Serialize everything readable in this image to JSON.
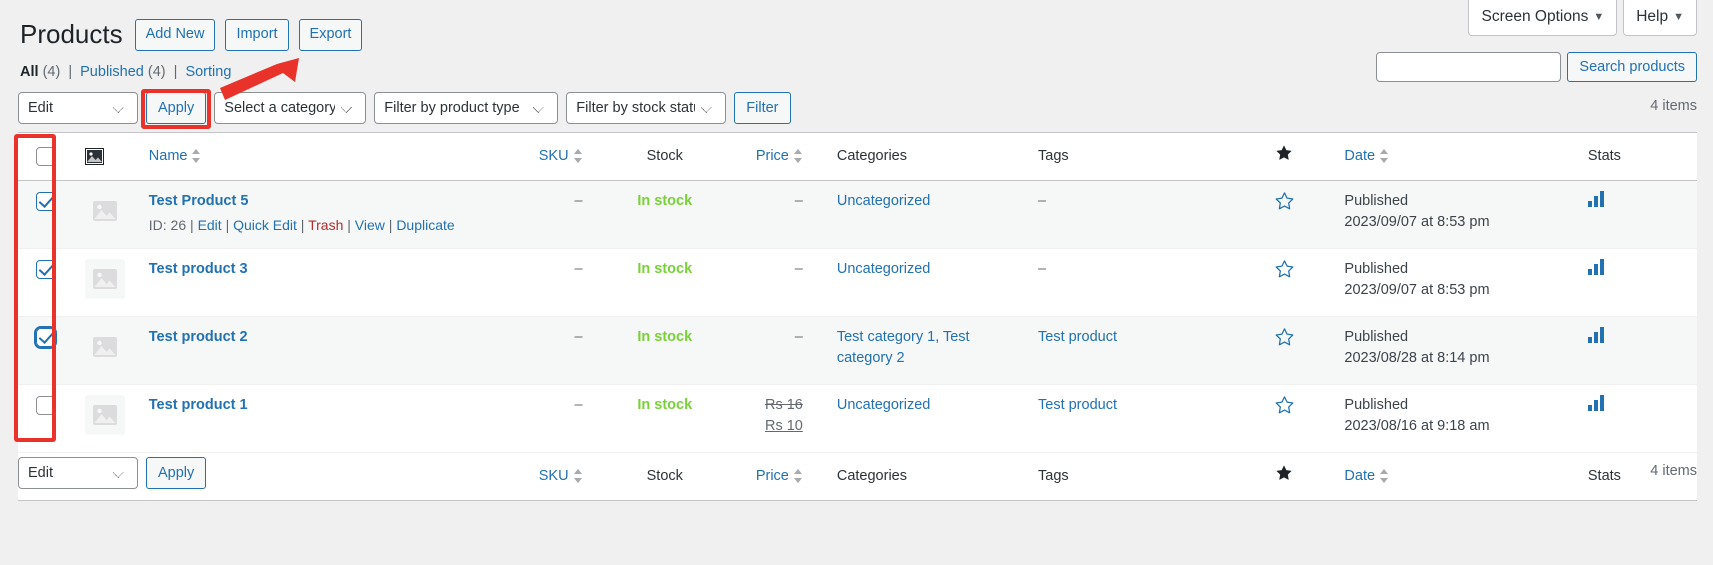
{
  "screen_meta": {
    "screen_options_label": "Screen Options",
    "help_label": "Help",
    "caret": "▼"
  },
  "header": {
    "title": "Products",
    "actions": [
      {
        "label": "Add New",
        "name": "add-new-button"
      },
      {
        "label": "Import",
        "name": "import-button"
      },
      {
        "label": "Export",
        "name": "export-button"
      }
    ]
  },
  "views": {
    "all_label": "All",
    "all_count": "(4)",
    "published_label": "Published",
    "published_count": "(4)",
    "sorting_label": "Sorting",
    "separator": "|"
  },
  "search": {
    "value": "",
    "placeholder": "",
    "submit_label": "Search products"
  },
  "tablenav_top": {
    "bulk_action_value": "Edit",
    "apply_label": "Apply",
    "category_value": "Select a category",
    "product_type_value": "Filter by product type",
    "stock_status_value": "Filter by stock status",
    "filter_label": "Filter",
    "displaying_num": "4 items"
  },
  "tablenav_bottom": {
    "bulk_action_value": "Edit",
    "apply_label": "Apply",
    "displaying_num": "4 items"
  },
  "table": {
    "columns": {
      "cb": "",
      "thumb": "image-icon",
      "name": "Name",
      "sku": "SKU",
      "stock": "Stock",
      "price": "Price",
      "categories": "Categories",
      "tags": "Tags",
      "featured": "★",
      "date": "Date",
      "stats": "Stats"
    },
    "rows": [
      {
        "checked": true,
        "focused": false,
        "title": "Test Product 5",
        "id_label": "ID: 26",
        "actions": [
          "Edit",
          "Quick Edit",
          "Trash",
          "View",
          "Duplicate"
        ],
        "sku": "–",
        "stock": "In stock",
        "price": "–",
        "price_sale": "",
        "categories": "Uncategorized",
        "tags": "–",
        "featured": false,
        "date_state": "Published",
        "date_value": "2023/09/07 at 8:53 pm"
      },
      {
        "checked": true,
        "focused": false,
        "title": "Test product 3",
        "id_label": "",
        "actions": [],
        "sku": "–",
        "stock": "In stock",
        "price": "–",
        "price_sale": "",
        "categories": "Uncategorized",
        "tags": "–",
        "featured": false,
        "date_state": "Published",
        "date_value": "2023/09/07 at 8:53 pm"
      },
      {
        "checked": true,
        "focused": true,
        "title": "Test product 2",
        "id_label": "",
        "actions": [],
        "sku": "–",
        "stock": "In stock",
        "price": "–",
        "price_sale": "",
        "categories": "Test category 1, Test category 2",
        "tags": "Test product",
        "featured": false,
        "date_state": "Published",
        "date_value": "2023/08/28 at 8:14 pm"
      },
      {
        "checked": false,
        "focused": false,
        "title": "Test product 1",
        "id_label": "",
        "actions": [],
        "sku": "–",
        "stock": "In stock",
        "price": "Rs 16",
        "price_sale": "Rs 10",
        "categories": "Uncategorized",
        "tags": "Test product",
        "featured": false,
        "date_state": "Published",
        "date_value": "2023/08/16 at 9:18 am"
      }
    ]
  },
  "colors": {
    "link": "#2271b1",
    "in_stock": "#7ad03a",
    "trash": "#b32d2e",
    "annotation": "#e8322a",
    "stats_bar": "#2271b1"
  }
}
